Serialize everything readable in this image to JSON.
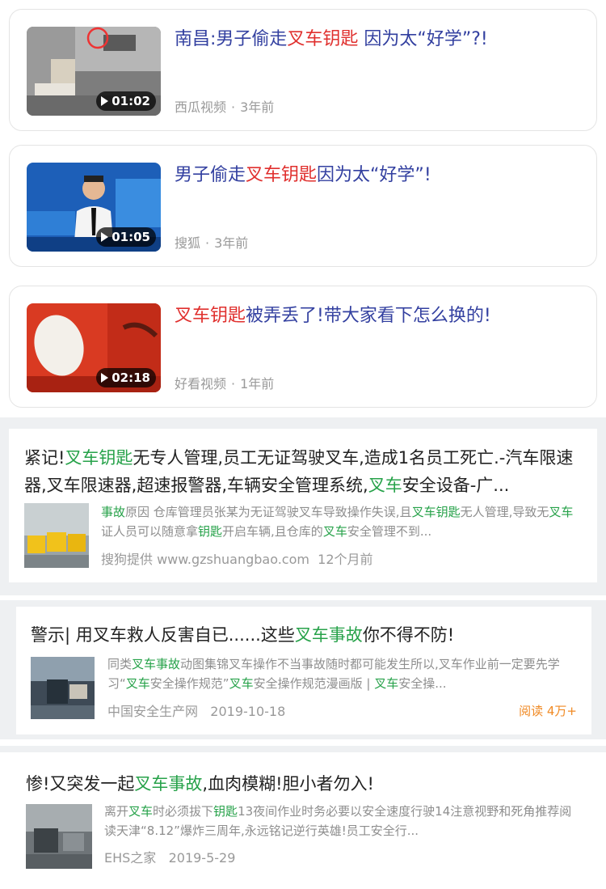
{
  "videos": [
    {
      "title_parts": [
        {
          "t": "南昌:男子偷走",
          "hl": false
        },
        {
          "t": "叉车钥匙",
          "hl": true
        },
        {
          "t": " 因为太“好学”?!",
          "hl": false
        }
      ],
      "duration": "01:02",
      "source": "西瓜视频",
      "age": "3年前"
    },
    {
      "title_parts": [
        {
          "t": "男子偷走",
          "hl": false
        },
        {
          "t": "叉车钥匙",
          "hl": true
        },
        {
          "t": "因为太“好学”!",
          "hl": false
        }
      ],
      "duration": "01:05",
      "source": "搜狐",
      "age": "3年前"
    },
    {
      "title_parts": [
        {
          "t": "叉车钥匙",
          "hl": true
        },
        {
          "t": "被弄丢了!带大家看下怎么换的!",
          "hl": false
        }
      ],
      "duration": "02:18",
      "source": "好看视频",
      "age": "1年前"
    }
  ],
  "article1": {
    "title_parts": [
      {
        "t": "紧记!",
        "hl": false
      },
      {
        "t": "叉车钥匙",
        "hl": true
      },
      {
        "t": "无专人管理,员工无证驾驶叉车,造成1名员工死亡.-汽车限速器,叉车限速器,超速报警器,车辆安全管理系统,",
        "hl": false
      },
      {
        "t": "叉车",
        "hl": true
      },
      {
        "t": "安全设备-广...",
        "hl": false
      }
    ],
    "snippet_parts": [
      {
        "t": "事故",
        "hl": true
      },
      {
        "t": "原因 仓库管理员张某为无证驾驶叉车导致操作失误,且",
        "hl": false
      },
      {
        "t": "叉车钥匙",
        "hl": true
      },
      {
        "t": "无人管理,导致无",
        "hl": false
      },
      {
        "t": "叉车",
        "hl": true
      },
      {
        "t": "证人员可以随意拿",
        "hl": false
      },
      {
        "t": "钥匙",
        "hl": true
      },
      {
        "t": "开启车辆,且仓库的",
        "hl": false
      },
      {
        "t": "叉车",
        "hl": true
      },
      {
        "t": "安全管理不到...",
        "hl": false
      }
    ],
    "source": "搜狗提供 www.gzshuangbao.com",
    "time": "12个月前"
  },
  "article2": {
    "title_parts": [
      {
        "t": "警示| 用叉车救人反害自已......这些",
        "hl": false
      },
      {
        "t": "叉车事故",
        "hl": true
      },
      {
        "t": "你不得不防!",
        "hl": false
      }
    ],
    "snippet_parts": [
      {
        "t": "同类",
        "hl": false
      },
      {
        "t": "叉车事故",
        "hl": true
      },
      {
        "t": "动图集锦叉车操作不当事故随时都可能发生所以,叉车作业前一定要先学习“",
        "hl": false
      },
      {
        "t": "叉车",
        "hl": true
      },
      {
        "t": "安全操作规范”",
        "hl": false
      },
      {
        "t": "叉车",
        "hl": true
      },
      {
        "t": "安全操作规范漫画版 | ",
        "hl": false
      },
      {
        "t": "叉车",
        "hl": true
      },
      {
        "t": "安全操...",
        "hl": false
      }
    ],
    "source": "中国安全生产网",
    "date": "2019-10-18",
    "read_more": "阅读 4万+"
  },
  "article3": {
    "title_parts": [
      {
        "t": "惨!又突发一起",
        "hl": false
      },
      {
        "t": "叉车事故",
        "hl": true
      },
      {
        "t": ",血肉模糊!胆小者勿入!",
        "hl": false
      }
    ],
    "snippet_parts": [
      {
        "t": "离开",
        "hl": false
      },
      {
        "t": "叉车",
        "hl": true
      },
      {
        "t": "时必须拔下",
        "hl": false
      },
      {
        "t": "钥匙",
        "hl": true
      },
      {
        "t": "13夜间作业时务必要以安全速度行驶14注意视野和死角推荐阅读天津“8.12”爆炸三周年,永远铭记逆行英雄!员工安全行...",
        "hl": false
      }
    ],
    "source": "EHS之家",
    "date": "2019-5-29"
  },
  "colors": {
    "title_blue": "#3340a0",
    "highlight_red": "#e0302e",
    "highlight_green": "#27a24a",
    "meta_gray": "#9a9a9a",
    "read_orange": "#f08a24"
  },
  "icons": {
    "play": "play-icon"
  }
}
